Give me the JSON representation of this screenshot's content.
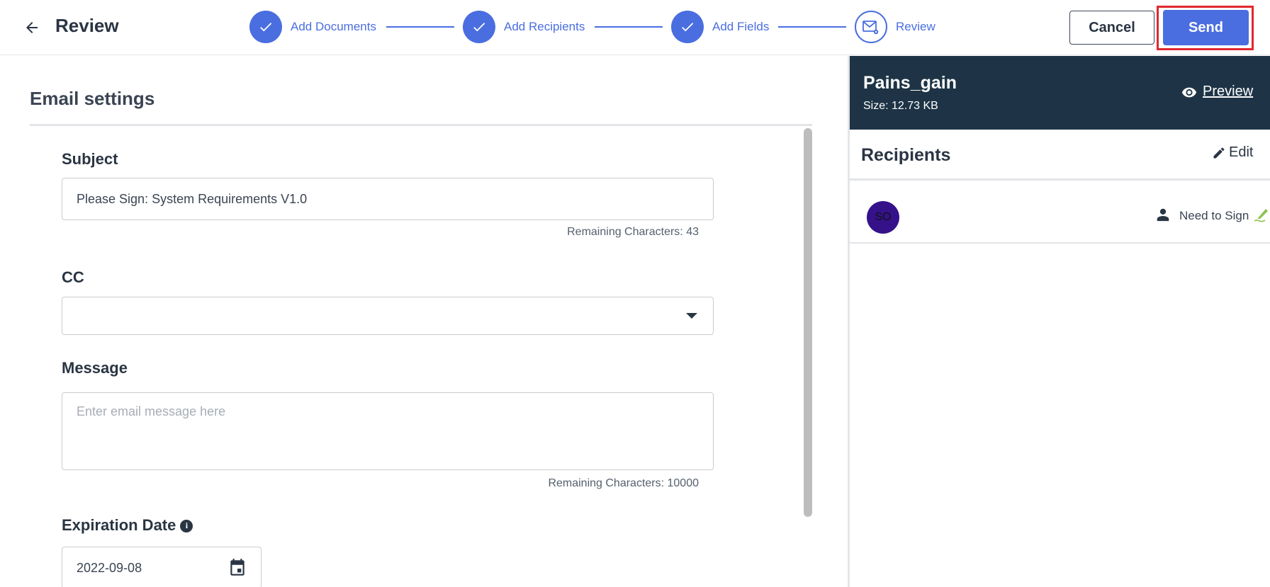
{
  "header": {
    "title": "Review",
    "back_icon": "arrow-left-icon",
    "steps": [
      {
        "label": "Add Documents",
        "status": "completed"
      },
      {
        "label": "Add Recipients",
        "status": "completed"
      },
      {
        "label": "Add Fields",
        "status": "completed"
      },
      {
        "label": "Review",
        "status": "current"
      }
    ],
    "cancel_label": "Cancel",
    "send_label": "Send"
  },
  "email_settings": {
    "title": "Email settings",
    "subject": {
      "label": "Subject",
      "value": "Please Sign: System Requirements V1.0",
      "remaining": "Remaining Characters: 43"
    },
    "cc": {
      "label": "CC",
      "value": ""
    },
    "message": {
      "label": "Message",
      "placeholder": "Enter email message here",
      "remaining": "Remaining Characters: 10000"
    },
    "expiration": {
      "label": "Expiration Date",
      "value": "2022-09-08"
    }
  },
  "document": {
    "name": "Pains_gain",
    "size": "Size: 12.73 KB",
    "preview_label": "Preview"
  },
  "recipients": {
    "title": "Recipients",
    "edit_label": "Edit",
    "items": [
      {
        "initials": "SO",
        "role": "Need to Sign"
      }
    ]
  },
  "colors": {
    "primary": "#4a6ee0",
    "doc_header_bg": "#1e3446",
    "highlight": "#e0282e",
    "avatar_bg": "#35128a",
    "sign_icon": "#8bc34a"
  }
}
